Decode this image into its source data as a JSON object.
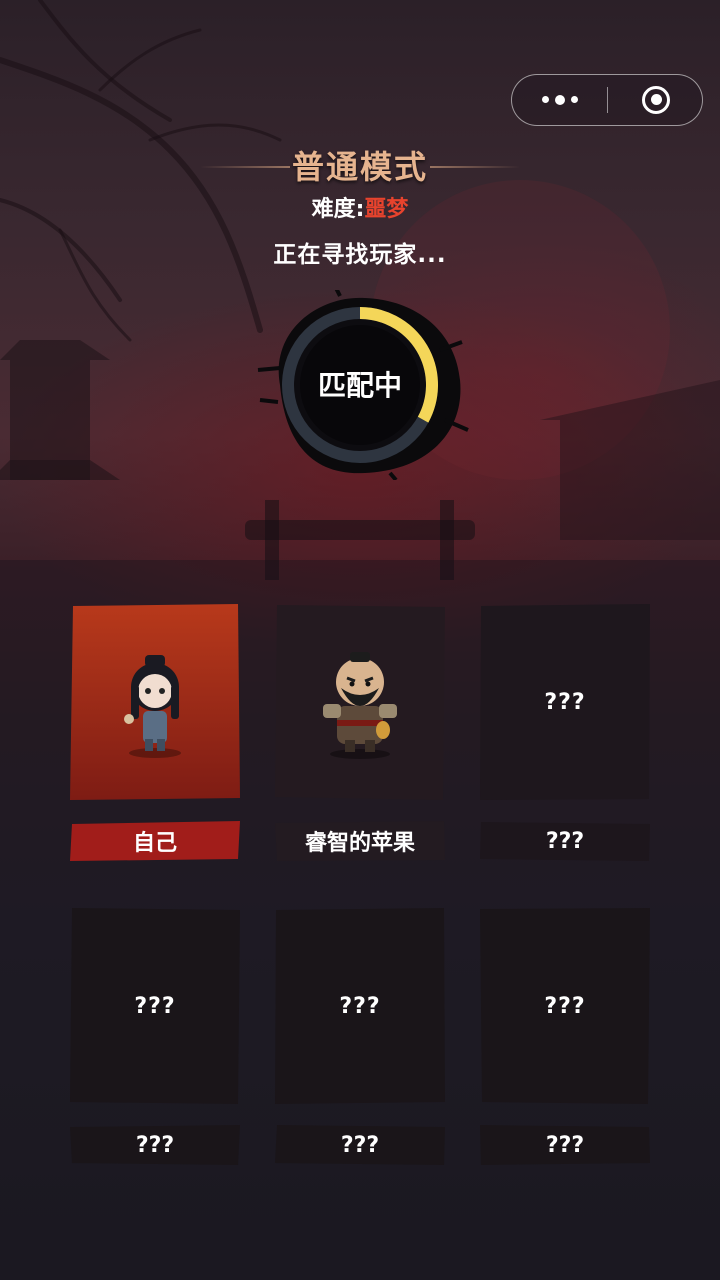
{
  "capsule": {
    "more_icon": "more-dots-icon",
    "close_icon": "close-target-icon"
  },
  "header": {
    "mode_title": "普通模式",
    "difficulty_label": "难度:",
    "difficulty_value": "噩梦",
    "status_text": "正在寻找玩家..."
  },
  "matching": {
    "label": "匹配中",
    "progress": 0.33,
    "accent_color": "#f4d659"
  },
  "players": [
    {
      "name": "自己",
      "card_label": "",
      "avatar": "girl-character"
    },
    {
      "name": "睿智的苹果",
      "card_label": "",
      "avatar": "warrior-character"
    },
    {
      "name": "???",
      "card_label": "???"
    },
    {
      "name": "???",
      "card_label": "???"
    },
    {
      "name": "???",
      "card_label": "???"
    },
    {
      "name": "???",
      "card_label": "???"
    }
  ],
  "colors": {
    "self_card": "#b33a1a",
    "title": "#e6b48f",
    "difficulty": "#e8432d"
  }
}
